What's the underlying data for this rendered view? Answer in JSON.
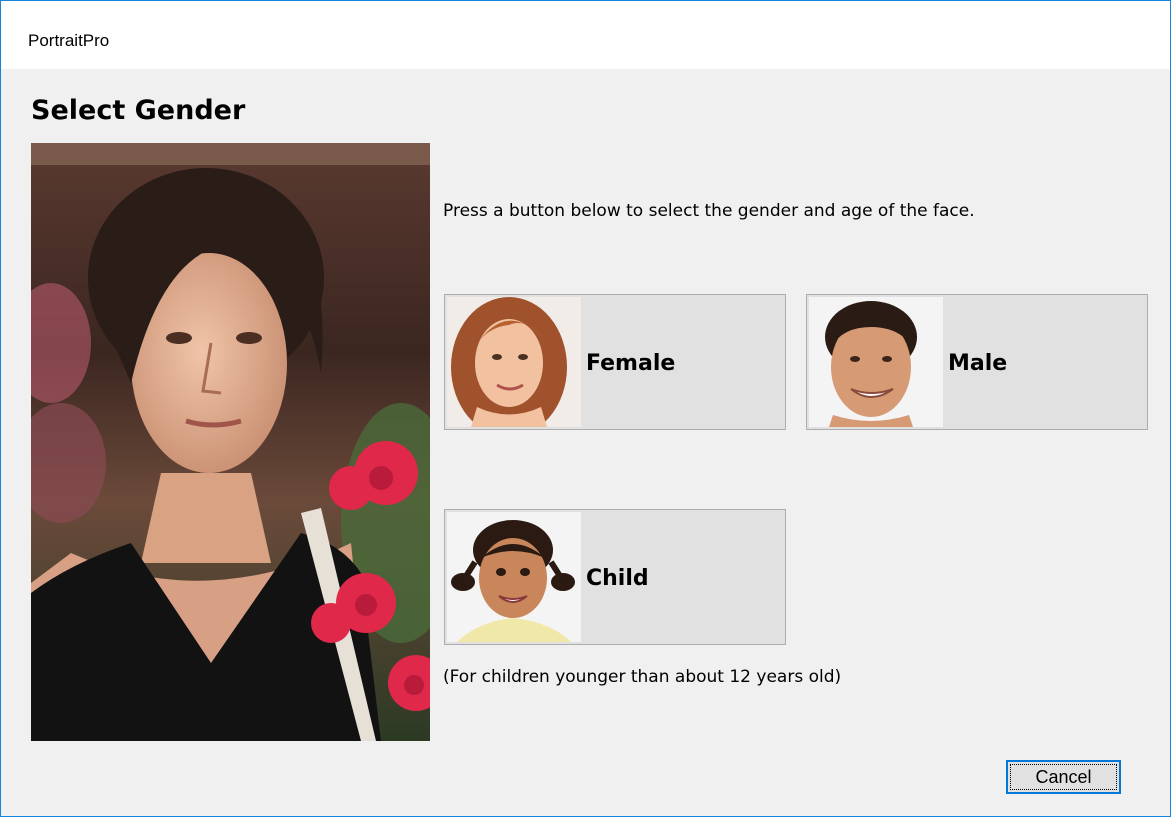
{
  "window": {
    "title": "PortraitPro"
  },
  "dialog": {
    "heading": "Select Gender",
    "instruction": "Press a button below to select the gender and age of the face.",
    "buttons": {
      "female": "Female",
      "male": "Male",
      "child": "Child"
    },
    "child_note": "(For children younger than about 12 years old)",
    "cancel_label": "Cancel"
  },
  "colors": {
    "window_border": "#1883d7",
    "button_face": "#e1e1e1",
    "button_border": "#adadad",
    "focus_border": "#0078d7"
  }
}
